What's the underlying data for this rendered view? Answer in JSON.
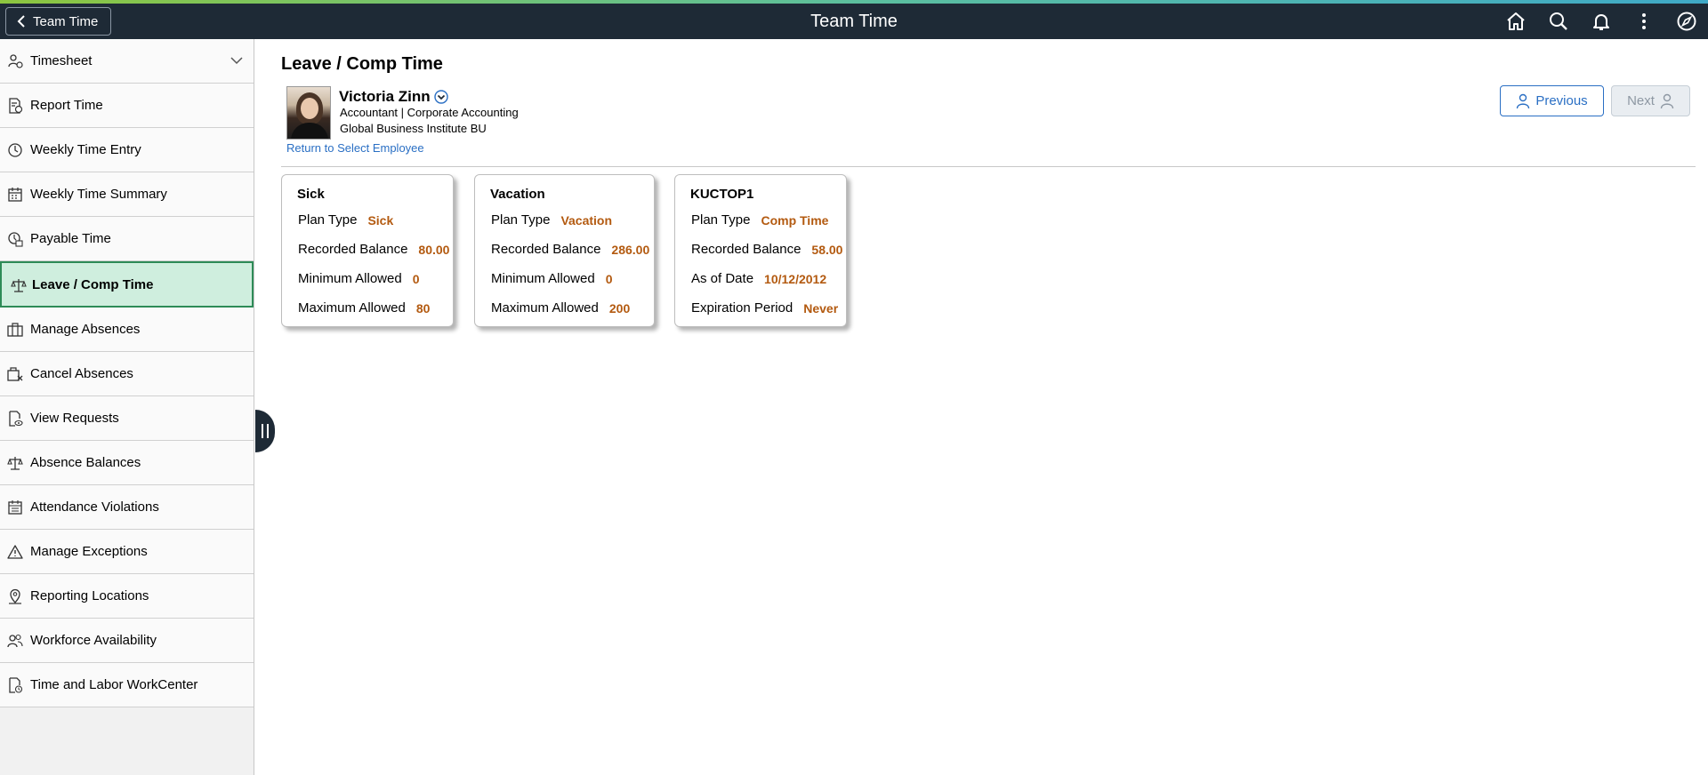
{
  "header": {
    "back_label": "Team Time",
    "title": "Team Time",
    "icons": [
      "home-icon",
      "search-icon",
      "notifications-icon",
      "actions-menu-icon",
      "navbar-compass-icon"
    ]
  },
  "sidebar": {
    "items": [
      {
        "label": "Timesheet",
        "icon": "timesheet-icon",
        "expandable": true
      },
      {
        "label": "Report Time",
        "icon": "report-time-icon"
      },
      {
        "label": "Weekly Time Entry",
        "icon": "weekly-time-entry-icon"
      },
      {
        "label": "Weekly Time Summary",
        "icon": "weekly-time-summary-icon"
      },
      {
        "label": "Payable Time",
        "icon": "payable-time-icon"
      },
      {
        "label": "Leave / Comp Time",
        "icon": "scales-icon",
        "active": true
      },
      {
        "label": "Manage Absences",
        "icon": "manage-absences-icon"
      },
      {
        "label": "Cancel Absences",
        "icon": "cancel-absences-icon"
      },
      {
        "label": "View Requests",
        "icon": "view-requests-icon"
      },
      {
        "label": "Absence Balances",
        "icon": "scales-icon"
      },
      {
        "label": "Attendance Violations",
        "icon": "calendar-icon"
      },
      {
        "label": "Manage Exceptions",
        "icon": "warning-icon"
      },
      {
        "label": "Reporting Locations",
        "icon": "location-icon"
      },
      {
        "label": "Workforce Availability",
        "icon": "people-icon"
      },
      {
        "label": "Time and Labor WorkCenter",
        "icon": "workcenter-icon"
      }
    ]
  },
  "main": {
    "page_title": "Leave / Comp Time",
    "employee": {
      "name": "Victoria Zinn",
      "title_line": "Accountant | Corporate Accounting",
      "bu_line": "Global Business Institute BU",
      "return_link": "Return to Select Employee"
    },
    "previous_label": "Previous",
    "next_label": "Next",
    "cards": [
      {
        "title": "Sick",
        "rows": [
          {
            "label": "Plan Type",
            "value": "Sick"
          },
          {
            "label": "Recorded Balance",
            "value": "80.00"
          },
          {
            "label": "Minimum Allowed",
            "value": "0"
          },
          {
            "label": "Maximum Allowed",
            "value": "80"
          }
        ]
      },
      {
        "title": "Vacation",
        "rows": [
          {
            "label": "Plan Type",
            "value": "Vacation"
          },
          {
            "label": "Recorded Balance",
            "value": "286.00"
          },
          {
            "label": "Minimum Allowed",
            "value": "0"
          },
          {
            "label": "Maximum Allowed",
            "value": "200"
          }
        ]
      },
      {
        "title": "KUCTOP1",
        "rows": [
          {
            "label": "Plan Type",
            "value": "Comp Time"
          },
          {
            "label": "Recorded Balance",
            "value": "58.00"
          },
          {
            "label": "As of Date",
            "value": "10/12/2012"
          },
          {
            "label": "Expiration Period",
            "value": "Never"
          }
        ]
      }
    ]
  },
  "colors": {
    "header_bg": "#1e2a36",
    "active_nav_bg": "#cfeede",
    "active_nav_border": "#2e8b57",
    "value_color": "#b35a10",
    "link_color": "#2a6fc4"
  }
}
